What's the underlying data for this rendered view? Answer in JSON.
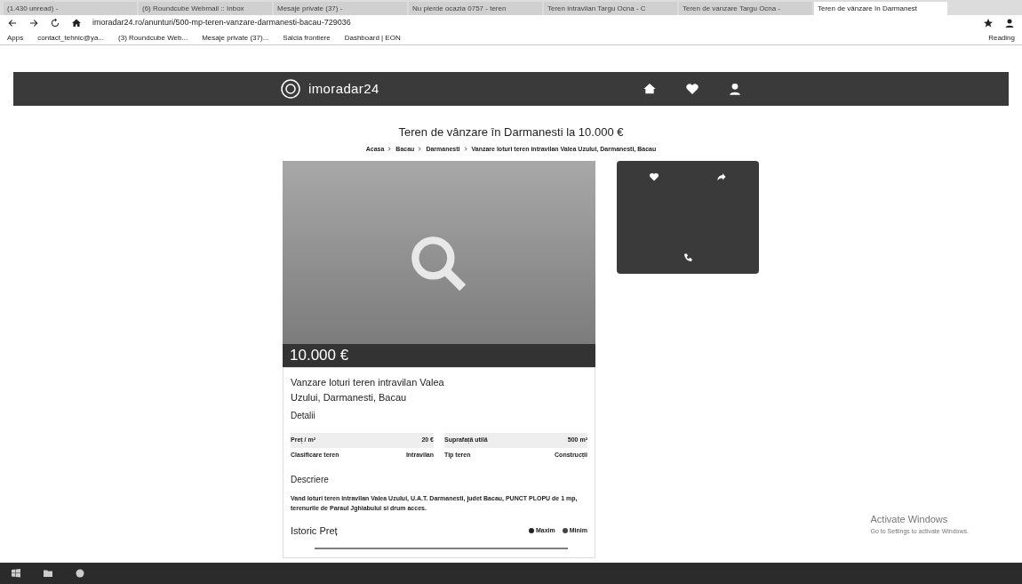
{
  "browser": {
    "tabs": [
      {
        "title": "(1.430 unread) - ",
        "selected": false
      },
      {
        "title": "(6) Roundcube Webmail :: Inbox",
        "selected": false
      },
      {
        "title": "Mesaje private (37) - ",
        "selected": false
      },
      {
        "title": "Nu pierde ocazia 0757 - teren",
        "selected": false
      },
      {
        "title": "Teren intravilan Targu Ocna - C",
        "selected": false
      },
      {
        "title": "Teren de vanzare Targu Ocna -",
        "selected": false
      },
      {
        "title": "Teren de vânzare în Darmanest",
        "selected": true
      }
    ],
    "url": "imoradar24.ro/anunturi/500-mp-teren-vanzare-darmanesti-bacau-729036",
    "bookmarks": [
      "Apps",
      "contact_tehnic@ya...",
      "(3) Roundcube Web...",
      "Mesaje private (37)...",
      "Salcia frontiere",
      "Dashboard | EON"
    ],
    "reading_list": "Reading"
  },
  "site": {
    "logo": "imoradar24",
    "title": "Teren de vânzare în Darmanesti la 10.000 €",
    "breadcrumb": [
      "Acasa",
      "Bacau",
      "Darmanesti",
      "Vanzare loturi teren intravilan Valea Uzului, Darmanesti, Bacau"
    ],
    "price": "10.000 €",
    "listing_title": "Vanzare loturi teren intravilan Valea Uzului, Darmanesti, Bacau",
    "details_label": "Detalii",
    "specs": [
      {
        "label": "Preț / m²",
        "value": "20 €"
      },
      {
        "label": "Suprafață utilă",
        "value": "500 m²"
      },
      {
        "label": "Clasificare teren",
        "value": "Intravilan"
      },
      {
        "label": "Tip teren",
        "value": "Construcții"
      }
    ],
    "description_heading": "Descriere",
    "description": "Vand loturi teren intravilan Valea Uzului, U.A.T. Darmanesti, judet Bacau, PUNCT PLOPU de 1 mp, terenurile de Paraul Jghiabului si drum acces.",
    "history_heading": "Istoric Preț",
    "legend": [
      {
        "label": "Maxim",
        "color": "#222222"
      },
      {
        "label": "Minim",
        "color": "#444444"
      }
    ]
  },
  "watermark": {
    "title": "Activate Windows",
    "subtitle": "Go to Settings to activate Windows."
  }
}
